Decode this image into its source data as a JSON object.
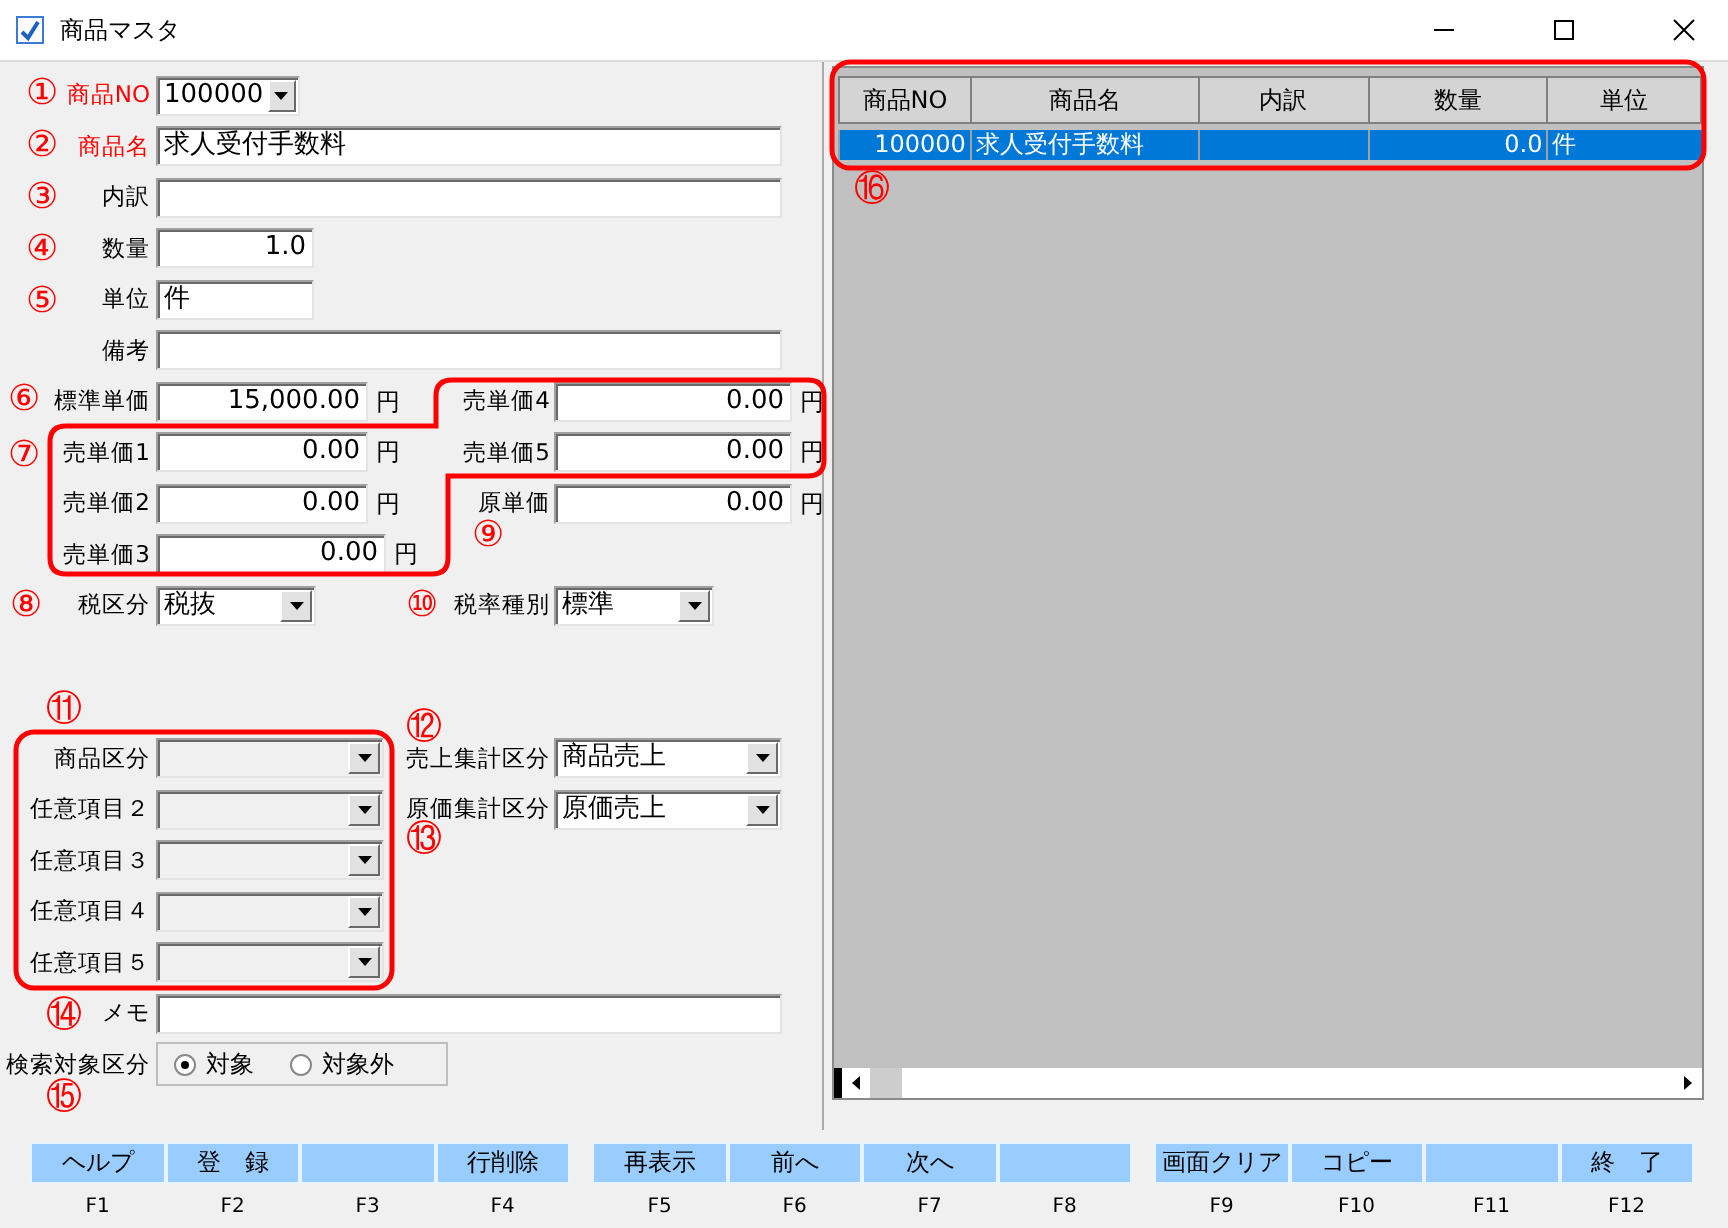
{
  "window": {
    "title": "商品マスタ"
  },
  "form_rows": [
    {
      "fields": [
        {
          "label": "商品NO",
          "kind": "combo",
          "value": "100000",
          "required": true,
          "disabled": false
        }
      ]
    },
    {
      "fields": [
        {
          "label": "商品名",
          "kind": "text",
          "value": "求人受付手数料",
          "required": true,
          "disabled": false
        }
      ]
    },
    {
      "fields": [
        {
          "label": "内訳",
          "kind": "text",
          "required": false,
          "disabled": false
        }
      ]
    },
    {
      "fields": [
        {
          "label": "数量",
          "kind": "number",
          "value": "1.0",
          "required": false,
          "disabled": false
        }
      ]
    },
    {
      "fields": [
        {
          "label": "単位",
          "kind": "text",
          "value": "件",
          "required": false,
          "disabled": false
        }
      ]
    },
    {
      "fields": [
        {
          "label": "備考",
          "kind": "text",
          "required": false,
          "disabled": false
        }
      ]
    },
    {
      "fields": [
        {
          "label": "標準単価",
          "kind": "number",
          "value": "15,000.00",
          "unit": "円",
          "required": false,
          "disabled": false
        },
        {
          "label": "売単価4",
          "kind": "number",
          "value": "0.00",
          "unit": "円",
          "required": false,
          "disabled": false
        }
      ]
    },
    {
      "fields": [
        {
          "label": "売単価1",
          "kind": "number",
          "value": "0.00",
          "unit": "円",
          "required": false,
          "disabled": false
        },
        {
          "label": "売単価5",
          "kind": "number",
          "value": "0.00",
          "unit": "円",
          "required": false,
          "disabled": false
        }
      ]
    },
    {
      "fields": [
        {
          "label": "売単価2",
          "kind": "number",
          "value": "0.00",
          "unit": "円",
          "required": false,
          "disabled": false
        },
        {
          "label": "原単価",
          "kind": "number",
          "value": "0.00",
          "unit": "円",
          "required": false,
          "disabled": false
        }
      ]
    },
    {
      "fields": [
        {
          "label": "売単価3",
          "kind": "number",
          "value": "0.00",
          "unit": "円",
          "required": false,
          "disabled": false
        }
      ]
    },
    {
      "fields": [
        {
          "label": "税区分",
          "kind": "combo",
          "value": "税抜",
          "required": false,
          "disabled": false
        },
        {
          "label": "税率種別",
          "kind": "combo",
          "value": "標準",
          "required": false,
          "disabled": false
        }
      ]
    },
    {
      "fields": [
        {
          "label": "商品区分",
          "kind": "combo",
          "required": false,
          "disabled": true
        },
        {
          "label": "売上集計区分",
          "kind": "combo",
          "value": "商品売上",
          "required": false,
          "disabled": false
        }
      ]
    },
    {
      "fields": [
        {
          "label": "任意項目２",
          "kind": "combo",
          "required": false,
          "disabled": true
        },
        {
          "label": "原価集計区分",
          "kind": "combo",
          "value": "原価売上",
          "required": false,
          "disabled": false
        }
      ]
    },
    {
      "fields": [
        {
          "label": "任意項目３",
          "kind": "combo",
          "required": false,
          "disabled": true
        }
      ]
    },
    {
      "fields": [
        {
          "label": "任意項目４",
          "kind": "combo",
          "required": false,
          "disabled": true
        }
      ]
    },
    {
      "fields": [
        {
          "label": "任意項目５",
          "kind": "combo",
          "required": false,
          "disabled": true
        }
      ]
    },
    {
      "fields": [
        {
          "label": "メモ",
          "kind": "text",
          "required": false,
          "disabled": false
        }
      ]
    }
  ],
  "search_target": {
    "label": "検索対象区分",
    "options": [
      {
        "label": "対象",
        "selected": true
      },
      {
        "label": "対象外",
        "selected": false
      }
    ]
  },
  "grid": {
    "columns": [
      "商品NO",
      "商品名",
      "内訳",
      "数量",
      "単位"
    ],
    "rows": [
      {
        "cells": [
          "100000",
          "求人受付手数料",
          null,
          "0.0",
          "件"
        ],
        "selected": true
      }
    ]
  },
  "function_keys": [
    {
      "label": "ヘルプ",
      "key": "F1"
    },
    {
      "label": "登　録",
      "key": "F2"
    },
    {
      "key": "F3"
    },
    {
      "label": "行削除",
      "key": "F4"
    },
    {
      "label": "再表示",
      "key": "F5"
    },
    {
      "label": "前へ",
      "key": "F6"
    },
    {
      "label": "次へ",
      "key": "F7"
    },
    {
      "key": "F8"
    },
    {
      "label": "画面クリア",
      "key": "F9"
    },
    {
      "label": "コピー",
      "key": "F10"
    },
    {
      "key": "F11"
    },
    {
      "label": "終　了",
      "key": "F12"
    }
  ],
  "annotations": [
    {
      "label": "①"
    },
    {
      "label": "②"
    },
    {
      "label": "③"
    },
    {
      "label": "④"
    },
    {
      "label": "⑤"
    },
    {
      "label": "⑥"
    },
    {
      "label": "⑦"
    },
    {
      "label": "⑧"
    },
    {
      "label": "⑨"
    },
    {
      "label": "⑩"
    },
    {
      "label": "⑪"
    },
    {
      "label": "⑫"
    },
    {
      "label": "⑬"
    },
    {
      "label": "⑭"
    },
    {
      "label": "⑮"
    },
    {
      "label": "⑯"
    }
  ]
}
